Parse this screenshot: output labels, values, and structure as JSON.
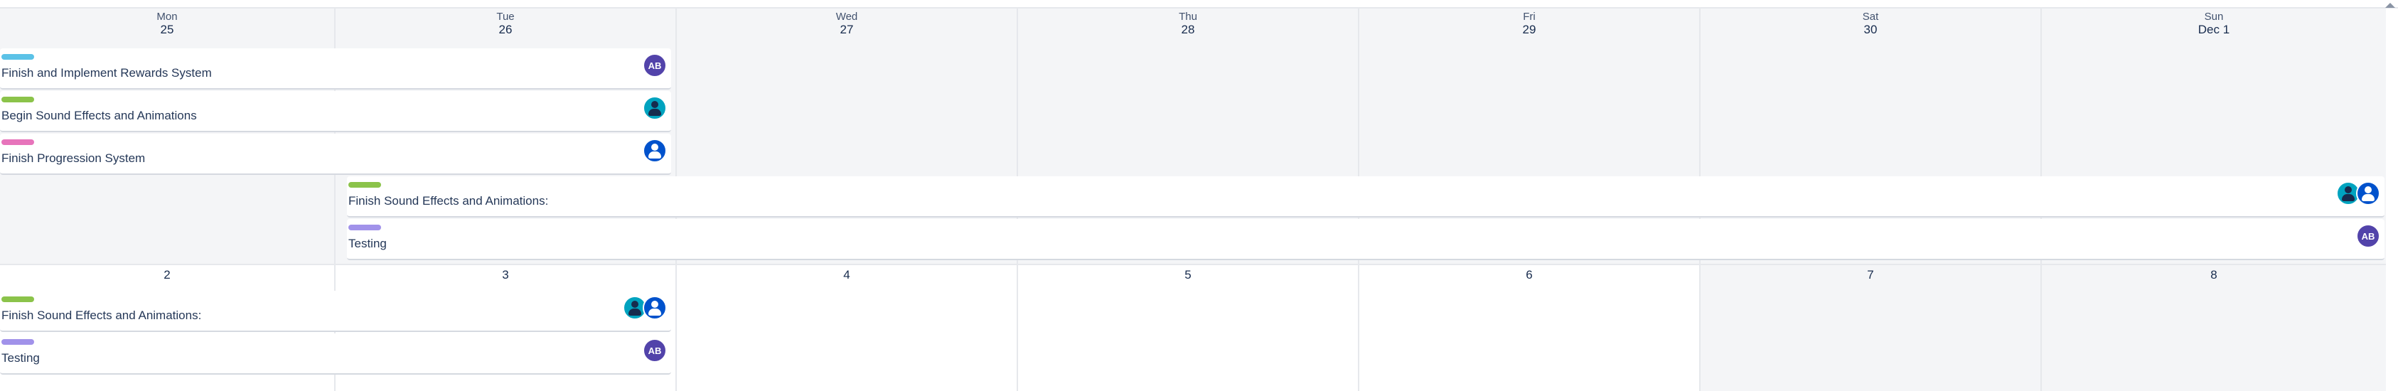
{
  "colors": {
    "teal": "#5bc2e7",
    "green": "#8bc34a",
    "pink": "#e774bb",
    "purple": "#a192ea"
  },
  "week1": {
    "days": [
      {
        "dow": "Mon",
        "num": "25"
      },
      {
        "dow": "Tue",
        "num": "26"
      },
      {
        "dow": "Wed",
        "num": "27"
      },
      {
        "dow": "Thu",
        "num": "28"
      },
      {
        "dow": "Fri",
        "num": "29"
      },
      {
        "dow": "Sat",
        "num": "30"
      },
      {
        "dow": "Sun",
        "num": "Dec 1"
      }
    ],
    "events": [
      {
        "title": "Finish and Implement Rewards System",
        "color": "teal",
        "avatars": [
          "AB"
        ]
      },
      {
        "title": "Begin Sound Effects and Animations",
        "color": "green",
        "avatars": [
          "teal-person-icon"
        ]
      },
      {
        "title": "Finish Progression System",
        "color": "pink",
        "avatars": [
          "blue-person-icon"
        ]
      },
      {
        "title": "Finish Sound Effects and Animations:",
        "color": "green",
        "avatars": [
          "teal-person-icon",
          "blue-person-icon"
        ]
      },
      {
        "title": "Testing",
        "color": "purple",
        "avatars": [
          "AB"
        ]
      }
    ]
  },
  "week2": {
    "days": [
      {
        "num": "2"
      },
      {
        "num": "3"
      },
      {
        "num": "4"
      },
      {
        "num": "5"
      },
      {
        "num": "6"
      },
      {
        "num": "7"
      },
      {
        "num": "8"
      }
    ],
    "events": [
      {
        "title": "Finish Sound Effects and Animations:",
        "color": "green",
        "avatars": [
          "teal-person-icon",
          "blue-person-icon"
        ]
      },
      {
        "title": "Testing",
        "color": "purple",
        "avatars": [
          "AB"
        ]
      }
    ]
  }
}
